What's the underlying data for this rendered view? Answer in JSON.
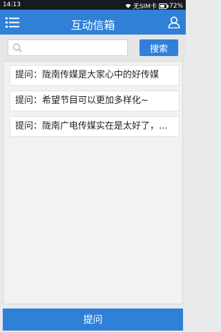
{
  "status_bar": {
    "time": "14:13",
    "carrier": "无SIM卡",
    "battery": "72%",
    "battery_level": 0.72
  },
  "header": {
    "title": "互动信箱",
    "left_icon": "list-menu-icon",
    "right_icon": "user-icon"
  },
  "search": {
    "placeholder": "",
    "value": "",
    "button_label": "搜索",
    "icon": "search-icon"
  },
  "questions": [
    {
      "text": "提问：陇南传媒是大家心中的好传媒"
    },
    {
      "text": "提问：希望节目可以更加多样化~"
    },
    {
      "text": "提问：陇南广电传媒实在是太好了，..."
    }
  ],
  "footer": {
    "ask_button_label": "提问"
  },
  "colors": {
    "accent": "#2f80d6",
    "status_bar": "#161b20",
    "background": "#e9eaeb"
  }
}
